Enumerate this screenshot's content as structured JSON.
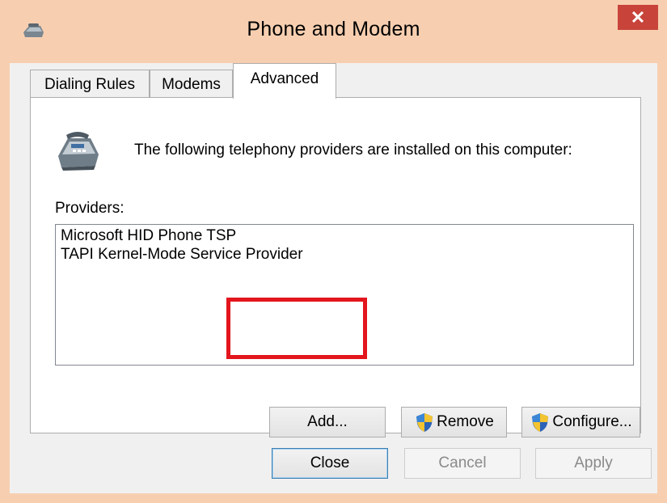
{
  "window": {
    "title": "Phone and Modem",
    "close_glyph": "✕",
    "titlebar_color": "#f7cfb0",
    "close_color": "#c8443a"
  },
  "tabs": [
    {
      "label": "Dialing Rules",
      "active": false
    },
    {
      "label": "Modems",
      "active": false
    },
    {
      "label": "Advanced",
      "active": true
    }
  ],
  "advanced": {
    "intro_text": "The following telephony providers are installed on this computer:",
    "providers_label": "Providers:",
    "providers": [
      "Microsoft HID Phone TSP",
      "TAPI Kernel-Mode Service Provider"
    ],
    "buttons": {
      "add": "Add...",
      "remove": "Remove",
      "configure": "Configure..."
    }
  },
  "footer": {
    "close": "Close",
    "cancel": "Cancel",
    "apply": "Apply"
  },
  "annotation": {
    "highlight_color": "#e3151d",
    "target": "Add..."
  }
}
